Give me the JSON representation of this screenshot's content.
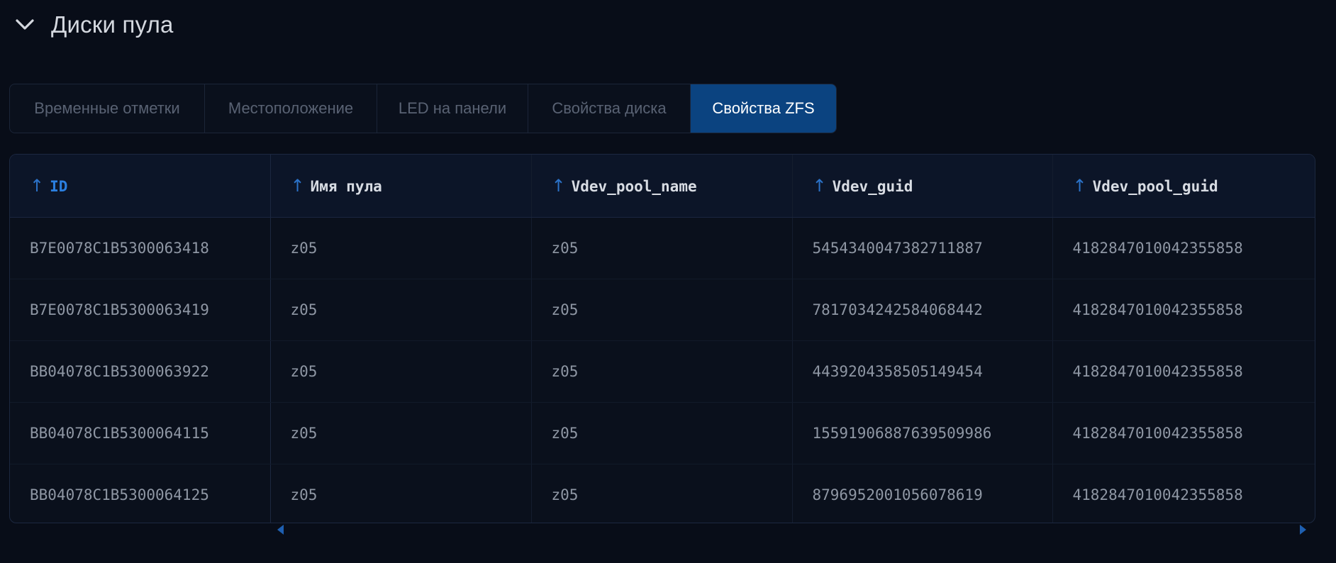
{
  "section": {
    "title": "Диски пула"
  },
  "tabs": [
    {
      "label": "Временные отметки",
      "active": false
    },
    {
      "label": "Местоположение",
      "active": false
    },
    {
      "label": "LED на панели",
      "active": false
    },
    {
      "label": "Свойства диска",
      "active": false
    },
    {
      "label": "Свойства ZFS",
      "active": true
    }
  ],
  "table": {
    "columns": [
      {
        "label": "ID",
        "sort_icon": "arrow-up-icon"
      },
      {
        "label": "Имя пула",
        "sort_icon": "arrow-up-icon"
      },
      {
        "label": "Vdev_pool_name",
        "sort_icon": "arrow-up-icon"
      },
      {
        "label": "Vdev_guid",
        "sort_icon": "arrow-up-icon"
      },
      {
        "label": "Vdev_pool_guid",
        "sort_icon": "arrow-up-icon"
      }
    ],
    "rows": [
      [
        "B7E0078C1B5300063418",
        "z05",
        "z05",
        "5454340047382711887",
        "4182847010042355858"
      ],
      [
        "B7E0078C1B5300063419",
        "z05",
        "z05",
        "7817034242584068442",
        "4182847010042355858"
      ],
      [
        "BB04078C1B5300063922",
        "z05",
        "z05",
        "4439204358505149454",
        "4182847010042355858"
      ],
      [
        "BB04078C1B5300064115",
        "z05",
        "z05",
        "15591906887639509986",
        "4182847010042355858"
      ],
      [
        "BB04078C1B5300064125",
        "z05",
        "z05",
        "8796952001056078619",
        "4182847010042355858"
      ]
    ]
  },
  "colors": {
    "background": "#080d18",
    "accent": "#0b4380",
    "sort_active": "#2b7fe0"
  }
}
